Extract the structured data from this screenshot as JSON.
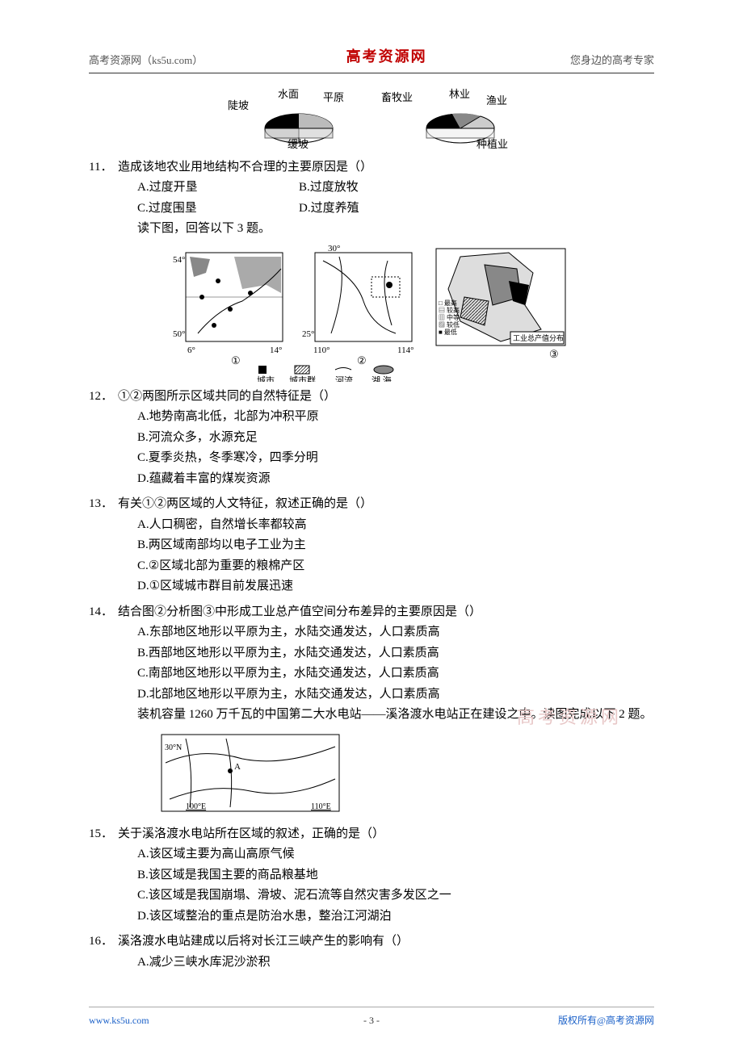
{
  "header": {
    "left": "高考资源网（ks5u.com）",
    "center": "高考资源网",
    "right": "您身边的高考专家"
  },
  "pie1": {
    "labels": {
      "l1": "陡坡",
      "l2": "水面",
      "l3": "平原",
      "l4": "缓坡"
    }
  },
  "pie2": {
    "labels": {
      "l1": "畜牧业",
      "l2": "林业",
      "l3": "渔业",
      "l4": "种植业"
    }
  },
  "q11": {
    "num": "11．",
    "text": "造成该地农业用地结构不合理的主要原因是（）",
    "a": "A.过度开垦",
    "b": "B.过度放牧",
    "c": "C.过度围垦",
    "d": "D.过度养殖"
  },
  "intro12": "读下图，回答以下 3 题。",
  "maps": {
    "m1": {
      "top": "54°",
      "bot": "50°",
      "left": "6°",
      "right": "14°",
      "circ": "①"
    },
    "m2": {
      "top": "30°",
      "bot": "25°",
      "left": "110°",
      "right": "114°",
      "circ": "②"
    },
    "m3": {
      "legend1": "□ 最高",
      "legend2": "▤ 较高",
      "legend3": "▥ 中等",
      "legend4": "▨ 较低",
      "legend5": "■ 最低",
      "title": "工业总产值分布",
      "circ": "③"
    },
    "legend_row": {
      "a": "城市",
      "b": "城市群",
      "c": "河流",
      "d": "湖,海"
    }
  },
  "q12": {
    "num": "12．",
    "text": "①②两图所示区域共同的自然特征是（）",
    "a": "A.地势南高北低，北部为冲积平原",
    "b": "B.河流众多，水源充足",
    "c": "C.夏季炎热，冬季寒冷，四季分明",
    "d": "D.蕴藏着丰富的煤炭资源"
  },
  "q13": {
    "num": "13．",
    "text": "有关①②两区域的人文特征，叙述正确的是（）",
    "a": "A.人口稠密，自然增长率都较高",
    "b": "B.两区域南部均以电子工业为主",
    "c": "C.②区域北部为重要的粮棉产区",
    "d": "D.①区域城市群目前发展迅速"
  },
  "q14": {
    "num": "14．",
    "text": "结合图②分析图③中形成工业总产值空间分布差异的主要原因是（）",
    "a": "A.东部地区地形以平原为主，水陆交通发达，人口素质高",
    "b": "B.西部地区地形以平原为主，水陆交通发达，人口素质高",
    "c": "C.南部地区地形以平原为主，水陆交通发达，人口素质高",
    "d": "D.北部地区地形以平原为主，水陆交通发达，人口素质高"
  },
  "intro15": "装机容量 1260 万千瓦的中国第二大水电站——溪洛渡水电站正在建设之中。读图完成以下 2 题。",
  "map15": {
    "lat": "30°N",
    "lonL": "100°E",
    "lonR": "110°E",
    "marker": "A"
  },
  "q15": {
    "num": "15．",
    "text": "关于溪洛渡水电站所在区域的叙述，正确的是（）",
    "a": "A.该区域主要为高山高原气候",
    "b": "B.该区域是我国主要的商品粮基地",
    "c": "C.该区域是我国崩塌、滑坡、泥石流等自然灾害多发区之一",
    "d": "D.该区域整治的重点是防治水患，整治江河湖泊"
  },
  "q16": {
    "num": "16．",
    "text": "溪洛渡水电站建成以后将对长江三峡产生的影响有（）",
    "a": "A.减少三峡水库泥沙淤积"
  },
  "watermark": "高考资源网",
  "footer": {
    "left": "www.ks5u.com",
    "center": "- 3 -",
    "right": "版权所有@高考资源网"
  }
}
